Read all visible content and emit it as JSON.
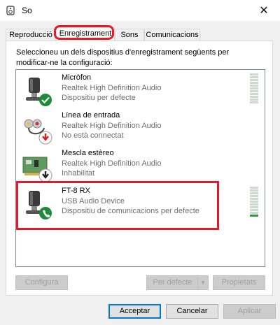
{
  "window": {
    "title": "So",
    "close_glyph": "✕"
  },
  "tabs": [
    {
      "label": "Reproducció",
      "active": false
    },
    {
      "label": "Enregistrament",
      "active": true
    },
    {
      "label": "Sons",
      "active": false
    },
    {
      "label": "Comunicacions",
      "active": false
    }
  ],
  "intro_text": "Seleccioneu un dels dispositius d'enregistrament següents per modificar-ne la configuració:",
  "devices": [
    {
      "name": "Micròfon",
      "driver": "Realtek High Definition Audio",
      "status": "Dispositiu per defecte",
      "icon": "microphone-icon",
      "badge": "default-check-badge",
      "meter_level": 0.0
    },
    {
      "name": "Línea de entrada",
      "driver": "Realtek High Definition Audio",
      "status": "No està connectat",
      "icon": "line-in-cable-icon",
      "badge": "disconnected-arrow-badge"
    },
    {
      "name": "Mescla estèreo",
      "driver": "Realtek High Definition Audio",
      "status": "Inhabilitat",
      "icon": "sound-card-icon",
      "badge": "disabled-arrow-badge"
    },
    {
      "name": "FT-8 RX",
      "driver": "USB Audio Device",
      "status": "Dispositiu de comunicacions per defecte",
      "icon": "microphone-icon",
      "badge": "communications-phone-badge",
      "meter_level": 0.1
    }
  ],
  "buttons": {
    "configure": "Configura",
    "set_default": "Per defecte",
    "properties": "Propietats",
    "ok": "Acceptar",
    "cancel": "Cancelar",
    "apply": "Aplicar"
  },
  "colors": {
    "highlight_red": "#e01b2b",
    "badge_green": "#1e8a3a",
    "badge_red": "#d21f1f",
    "meter_green": "#2a9b43"
  }
}
